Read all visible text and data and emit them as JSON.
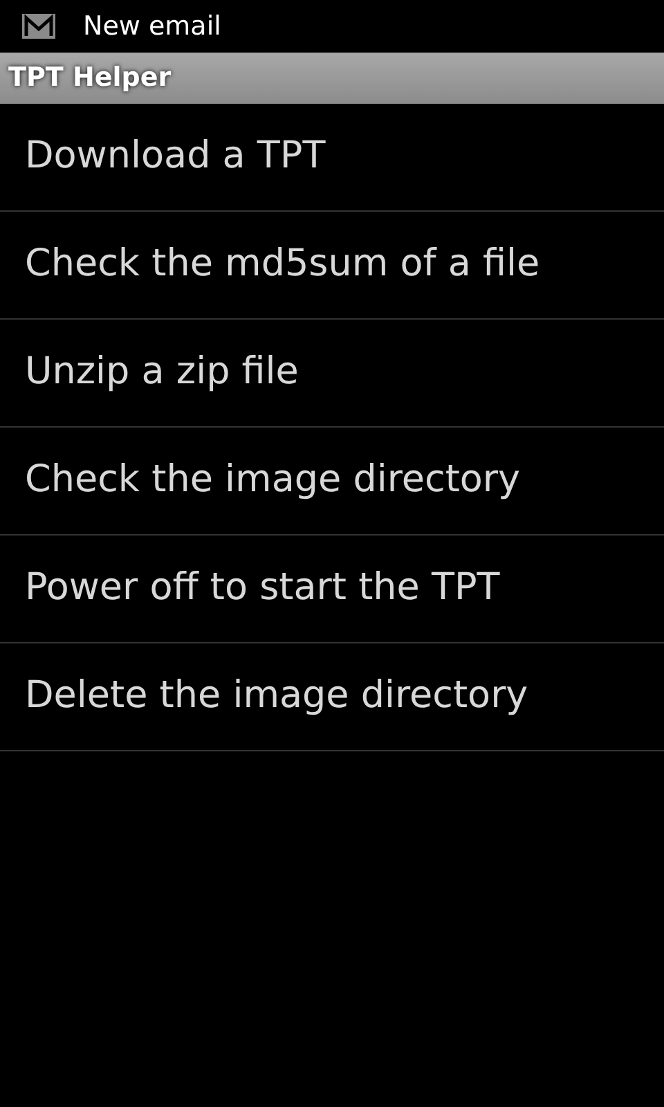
{
  "status_bar": {
    "notification": "New email"
  },
  "title_bar": {
    "title": "TPT Helper"
  },
  "menu_items": [
    "Download a TPT",
    "Check the md5sum of a file",
    "Unzip a zip file",
    "Check the image directory",
    "Power off to start the TPT",
    "Delete the image directory"
  ]
}
